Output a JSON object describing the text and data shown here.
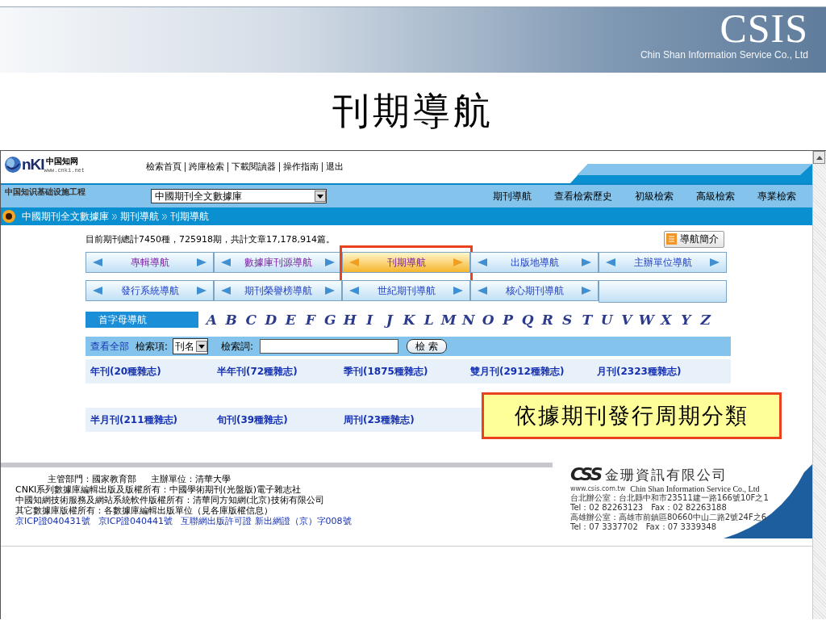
{
  "slide": {
    "brand": "CSIS",
    "brand_subtitle": "Chin Shan Information Service Co., Ltd",
    "title": "刊期導航"
  },
  "site": {
    "logo": {
      "mark": "nKI",
      "name": "中国知网",
      "url": "www.cnki.net"
    },
    "top_links": [
      "檢索首頁",
      "跨庫檢索",
      "下載閱讀器",
      "操作指南",
      "退出"
    ],
    "tagline": "中国知识基础设施工程",
    "database_select": {
      "value": "中國期刊全文數據庫"
    },
    "tabs": [
      "期刊導航",
      "查看檢索歷史",
      "初級檢索",
      "高級檢索",
      "專業檢索"
    ],
    "breadcrumb": [
      "中國期刊全文數據庫",
      "期刊導航",
      "刊期導航"
    ],
    "stats": "目前期刊總計7450種，725918期，共計文章17,178,914篇。",
    "intro_button": "導航簡介",
    "nav_rows": [
      [
        {
          "label": "專輯導航",
          "selected": false,
          "visited": true,
          "annotated": false
        },
        {
          "label": "數據庫刊源導航",
          "selected": false,
          "visited": true,
          "annotated": false
        },
        {
          "label": "刊期導航",
          "selected": true,
          "visited": true,
          "annotated": true
        },
        {
          "label": "出版地導航",
          "selected": false,
          "visited": false,
          "annotated": false
        },
        {
          "label": "主辦單位導航",
          "selected": false,
          "visited": false,
          "annotated": false
        }
      ],
      [
        {
          "label": "發行系統導航",
          "selected": false,
          "visited": false,
          "annotated": false
        },
        {
          "label": "期刊榮譽榜導航",
          "selected": false,
          "visited": false,
          "annotated": false
        },
        {
          "label": "世紀期刊導航",
          "selected": false,
          "visited": false,
          "annotated": false
        },
        {
          "label": "核心期刊導航",
          "selected": false,
          "visited": false,
          "annotated": false
        }
      ]
    ],
    "letter_nav": {
      "label": "首字母導航",
      "letters": [
        "A",
        "B",
        "C",
        "D",
        "E",
        "F",
        "G",
        "H",
        "I",
        "J",
        "K",
        "L",
        "M",
        "N",
        "O",
        "P",
        "Q",
        "R",
        "S",
        "T",
        "U",
        "V",
        "W",
        "X",
        "Y",
        "Z"
      ]
    },
    "search": {
      "view_all": "查看全部",
      "field_label": "檢索項:",
      "field_value": "刊名",
      "term_label": "檢索詞:",
      "button": "檢 索"
    },
    "periods": [
      [
        "年刊(20種雜志)",
        "半年刊(72種雜志)",
        "季刊(1875種雜志)",
        "雙月刊(2912種雜志)",
        "月刊(2323種雜志)"
      ],
      [
        "半月刊(211種雜志)",
        "旬刊(39種雜志)",
        "周刊(23種雜志)"
      ]
    ],
    "callout": "依據期刊發行周期分類",
    "footer": {
      "lines": [
        [
          "主管部門：國家教育部",
          "主辦單位：清華大學"
        ],
        [
          "CNKI系列數據庫編輯出版及版權所有：中國學術期刊(光盤版)電子雜志社"
        ],
        [
          "中國知網技術服務及網站系統軟件版權所有：清華同方知網(北京)技術有限公司"
        ],
        [
          "其它數據庫版權所有：各數據庫編輯出版單位（見各庫版權信息）"
        ]
      ],
      "links": [
        "京ICP證040431號",
        "京ICP證040441號",
        "互聯網出版許可證 新出網證（京）字008號"
      ],
      "company": {
        "mark": "CSS",
        "name": "金珊資訊有限公司",
        "name_en": "Chin Shan Information Service Co., Ltd",
        "url": "www.csis.com.tw",
        "contacts": [
          "台北辦公室：台北縣中和市23511建一路166號10F之1",
          "Tel：02 82263123　Fax：02 82263188",
          "高雄辦公室：高雄市前鎮區80660中山二路2號24F之6",
          "Tel：07 3337702　Fax：07 3339348"
        ]
      }
    }
  }
}
